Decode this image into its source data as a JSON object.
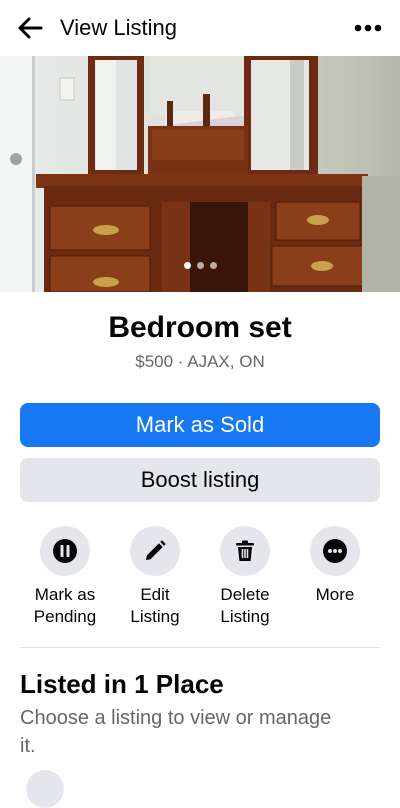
{
  "header": {
    "title": "View Listing",
    "back_icon": "back-arrow-icon",
    "menu_icon": "more-horizontal-icon"
  },
  "gallery": {
    "photo_count": 3,
    "active_index": 0
  },
  "listing": {
    "title": "Bedroom set",
    "subtitle": "$500 · AJAX, ON"
  },
  "buttons": {
    "mark_sold": "Mark as Sold",
    "boost": "Boost listing"
  },
  "actions": [
    {
      "label": "Mark as\nPending",
      "icon": "pause-icon"
    },
    {
      "label": "Edit\nListing",
      "icon": "pencil-icon"
    },
    {
      "label": "Delete\nListing",
      "icon": "trash-icon"
    },
    {
      "label": "More",
      "icon": "more-icon"
    }
  ],
  "places": {
    "title": "Listed in 1 Place",
    "subtitle": "Choose a listing to view or manage it."
  },
  "colors": {
    "primary": "#1877f2",
    "secondary_bg": "#e4e6eb",
    "muted_text": "#65676b"
  }
}
